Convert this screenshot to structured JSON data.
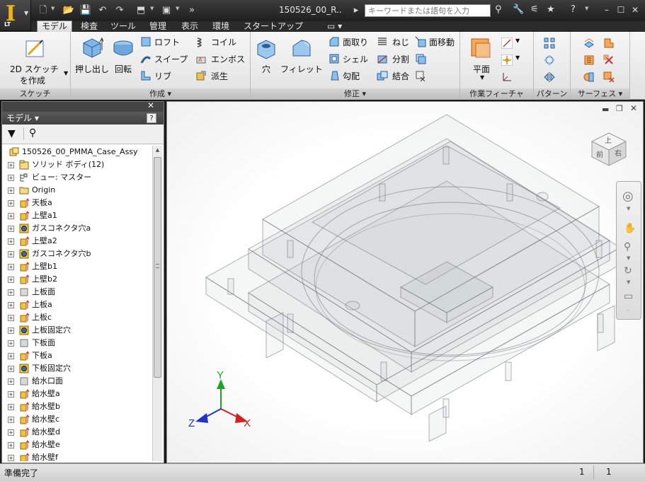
{
  "title": {
    "app_edition": "LT",
    "document": "150526_00_R..",
    "search_placeholder": "キーワードまたは語句を入力"
  },
  "tabs": [
    "モデル",
    "検査",
    "ツール",
    "管理",
    "表示",
    "環境",
    "スタートアップ"
  ],
  "ribbon": {
    "sketch": {
      "button": "2D スケッチ",
      "button2": "を作成",
      "panel": "スケッチ"
    },
    "create": {
      "extrude": "押し出し",
      "revolve": "回転",
      "loft": "ロフト",
      "sweep": "スイープ",
      "rib": "リブ",
      "coil": "コイル",
      "emboss": "エンボス",
      "derive": "派生",
      "panel": "作成 ▾"
    },
    "modify": {
      "hole": "穴",
      "fillet": "フィレット",
      "chamfer": "面取り",
      "shell": "シェル",
      "draft": "勾配",
      "thread": "ねじ",
      "split": "分割",
      "combine": "結合",
      "move_face": "面移動",
      "panel": "修正 ▾"
    },
    "work": {
      "plane": "平面",
      "panel": "作業フィーチャ"
    },
    "pattern": {
      "panel": "パターン"
    },
    "surface": {
      "panel": "サーフェス ▾"
    }
  },
  "browser": {
    "title": "モデル ▾",
    "items": [
      {
        "label": "150526_00_PMMA_Case_Assy",
        "icon": "assembly-icon"
      },
      {
        "label": "ソリッド ボディ(12)",
        "icon": "solid-bodies-icon"
      },
      {
        "label": "ビュー: マスター",
        "icon": "view-icon"
      },
      {
        "label": "Origin",
        "icon": "folder-icon"
      },
      {
        "label": "天板a",
        "icon": "extrude-icon"
      },
      {
        "label": "上壁a1",
        "icon": "extrude-icon"
      },
      {
        "label": "ガスコネクタ穴a",
        "icon": "hole-icon"
      },
      {
        "label": "上壁a2",
        "icon": "extrude-icon"
      },
      {
        "label": "ガスコネクタ穴b",
        "icon": "hole-icon"
      },
      {
        "label": "上壁b1",
        "icon": "extrude-icon"
      },
      {
        "label": "上壁b2",
        "icon": "extrude-icon"
      },
      {
        "label": "上板面",
        "icon": "workplane-icon"
      },
      {
        "label": "上板a",
        "icon": "extrude-icon"
      },
      {
        "label": "上板c",
        "icon": "extrude-icon"
      },
      {
        "label": "上板固定穴",
        "icon": "hole-icon"
      },
      {
        "label": "下板面",
        "icon": "workplane-icon"
      },
      {
        "label": "下板a",
        "icon": "extrude-icon"
      },
      {
        "label": "下板固定穴",
        "icon": "hole-icon"
      },
      {
        "label": "給水口面",
        "icon": "workplane-icon"
      },
      {
        "label": "給水壁a",
        "icon": "extrude-icon"
      },
      {
        "label": "給水壁b",
        "icon": "extrude-icon"
      },
      {
        "label": "給水壁c",
        "icon": "extrude-icon"
      },
      {
        "label": "給水壁d",
        "icon": "extrude-icon"
      },
      {
        "label": "給水壁e",
        "icon": "extrude-icon"
      },
      {
        "label": "給水壁f",
        "icon": "extrude-icon"
      }
    ]
  },
  "viewcube": {
    "top": "上",
    "front": "前",
    "right": "右"
  },
  "axes": {
    "x": "X",
    "y": "Y",
    "z": "Z"
  },
  "status": {
    "text": "準備完了",
    "n1": "1",
    "n2": "1"
  },
  "colors": {
    "accent": "#e8b423",
    "x_axis": "#d22020",
    "y_axis": "#1fa32a",
    "z_axis": "#2233cc"
  }
}
